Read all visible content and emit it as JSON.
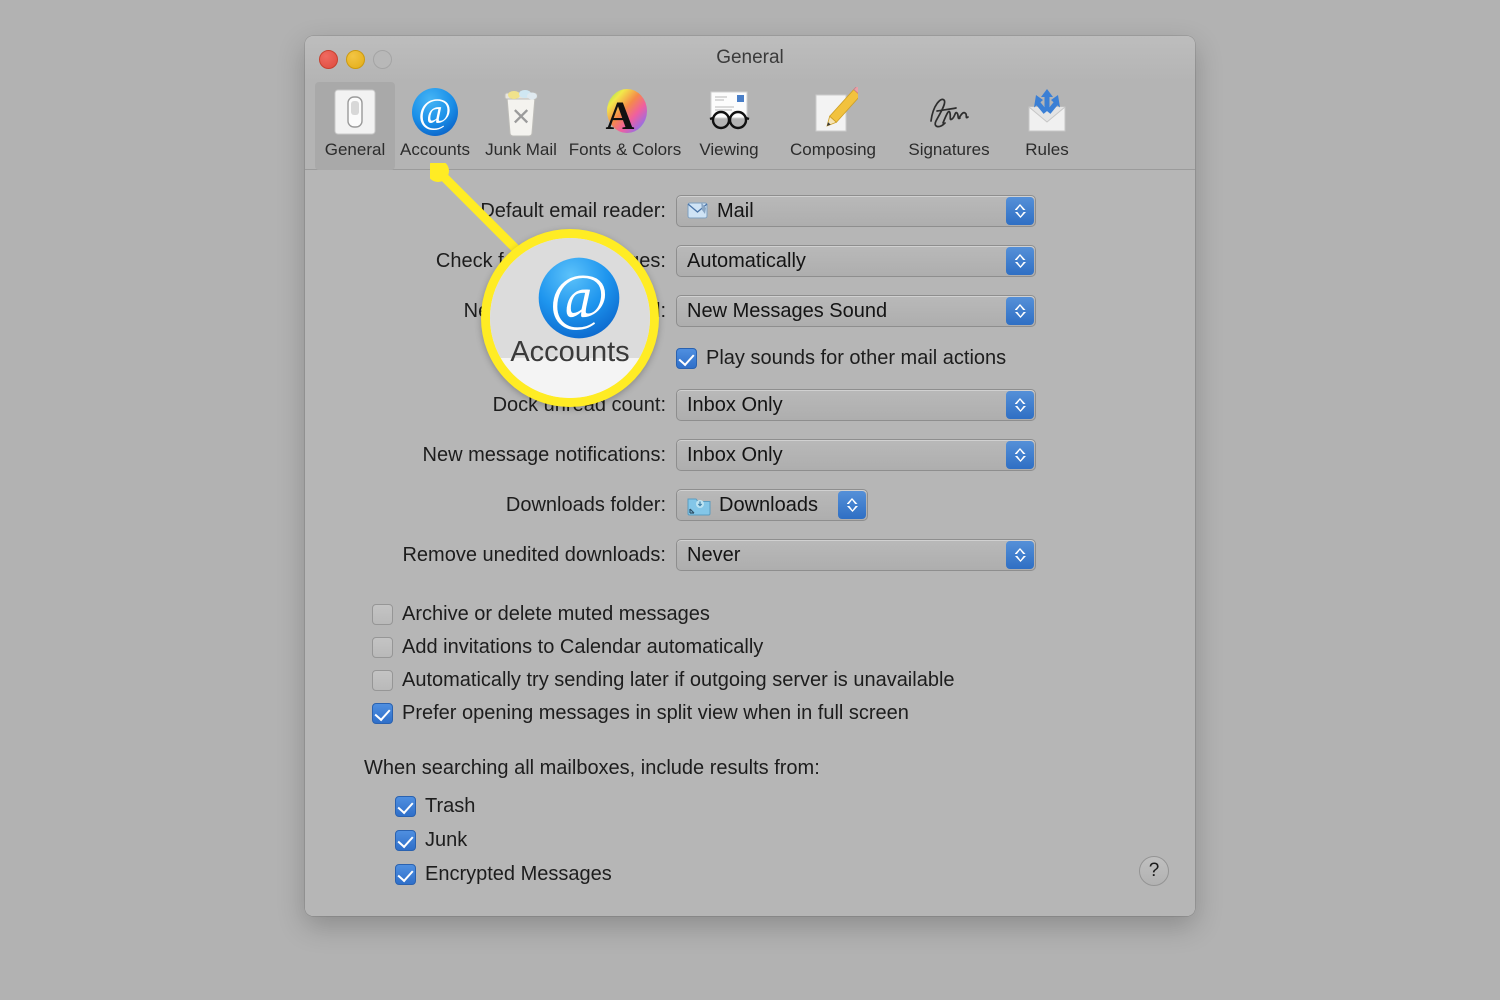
{
  "window": {
    "title": "General",
    "traffic_lights": [
      "close-button",
      "minimize-button",
      "zoom-button"
    ]
  },
  "toolbar": {
    "items": [
      {
        "label": "General",
        "icon": "toggle-switch-icon",
        "selected": true
      },
      {
        "label": "Accounts",
        "icon": "at-sign-icon",
        "selected": false
      },
      {
        "label": "Junk Mail",
        "icon": "trash-can-icon",
        "selected": false
      },
      {
        "label": "Fonts & Colors",
        "icon": "letter-a-color-wheel-icon",
        "selected": false
      },
      {
        "label": "Viewing",
        "icon": "eyeglasses-icon",
        "selected": false
      },
      {
        "label": "Composing",
        "icon": "pencil-paper-icon",
        "selected": false
      },
      {
        "label": "Signatures",
        "icon": "signature-icon",
        "selected": false
      },
      {
        "label": "Rules",
        "icon": "envelope-arrows-icon",
        "selected": false
      }
    ]
  },
  "settings": {
    "rows": [
      {
        "label": "Default email reader:",
        "value": "Mail",
        "icon": "mail-app-icon"
      },
      {
        "label": "Check for new messages:",
        "value": "Automatically",
        "icon": null
      },
      {
        "label": "New messages sound:",
        "value": "New Messages Sound",
        "icon": null
      },
      {
        "label": "Dock unread count:",
        "value": "Inbox Only",
        "icon": null
      },
      {
        "label": "New message notifications:",
        "value": "Inbox Only",
        "icon": null
      },
      {
        "label": "Downloads folder:",
        "value": "Downloads",
        "icon": "downloads-folder-icon"
      },
      {
        "label": "Remove unedited downloads:",
        "value": "Never",
        "icon": null
      }
    ],
    "play_sounds": {
      "label": "Play sounds for other mail actions",
      "checked": true
    },
    "checkboxes": [
      {
        "label": "Archive or delete muted messages",
        "checked": false
      },
      {
        "label": "Add invitations to Calendar automatically",
        "checked": false
      },
      {
        "label": "Automatically try sending later if outgoing server is unavailable",
        "checked": false
      },
      {
        "label": "Prefer opening messages in split view when in full screen",
        "checked": true
      }
    ],
    "search_group": {
      "label": "When searching all mailboxes, include results from:",
      "options": [
        {
          "label": "Trash",
          "checked": true
        },
        {
          "label": "Junk",
          "checked": true
        },
        {
          "label": "Encrypted Messages",
          "checked": true
        }
      ]
    },
    "help_label": "?"
  },
  "callout": {
    "magnified_label": "Accounts",
    "magnified_icon": "at-sign-icon",
    "highlight_color": "#ffec24"
  },
  "colors": {
    "desktop": "#b2b2b2",
    "window": "#b6b6b6",
    "accent_blue": "#2f6fc4",
    "highlight_yellow": "#ffec24"
  }
}
